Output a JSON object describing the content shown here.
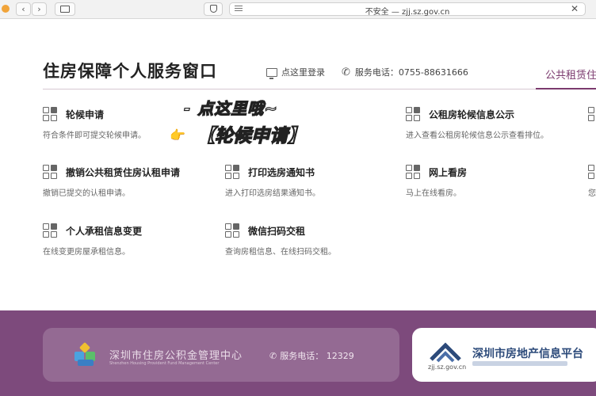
{
  "browser": {
    "address": "不安全 — zjj.sz.gov.cn",
    "back_icon": "chevron-left-icon",
    "forward_icon": "chevron-right-icon"
  },
  "header": {
    "title": "住房保障个人服务窗口",
    "login_label": "点这里登录",
    "phone_label": "服务电话：0755-88631666",
    "tab_right": "公共租赁住"
  },
  "items": [
    {
      "title": "轮候申请",
      "desc": "符合条件即可提交轮候申请。"
    },
    {
      "title": "公租房轮候信息公示",
      "desc": "进入查看公租房轮候信息公示查看排位。"
    },
    {
      "title": "撤销公共租赁住房认租申请",
      "desc": "撤销已提交的认租申请。"
    },
    {
      "title": "打印选房通知书",
      "desc": "进入打印选房结果通知书。"
    },
    {
      "title": "网上看房",
      "desc": "马上在线看房。"
    },
    {
      "title": "个人承租信息变更",
      "desc": "在线变更房屋承租信息。"
    },
    {
      "title": "微信扫码交租",
      "desc": "查询房租信息、在线扫码交租。"
    }
  ],
  "right_edge_desc": "您",
  "annotation": {
    "line1": "- 点这里哦~",
    "line2": "【轮候申请】"
  },
  "footer": {
    "fund_name": "深圳市住房公积金管理中心",
    "fund_en": "Shenzhen Housing Provident Fund Management Center",
    "fund_phone": "服务电话：  12329",
    "estate_name": "深圳市房地产信息平台",
    "estate_domain": "zjj.sz.gov.cn"
  },
  "colors": {
    "accent": "#7b3a6e",
    "footer_bg": "#7d4a7c"
  }
}
